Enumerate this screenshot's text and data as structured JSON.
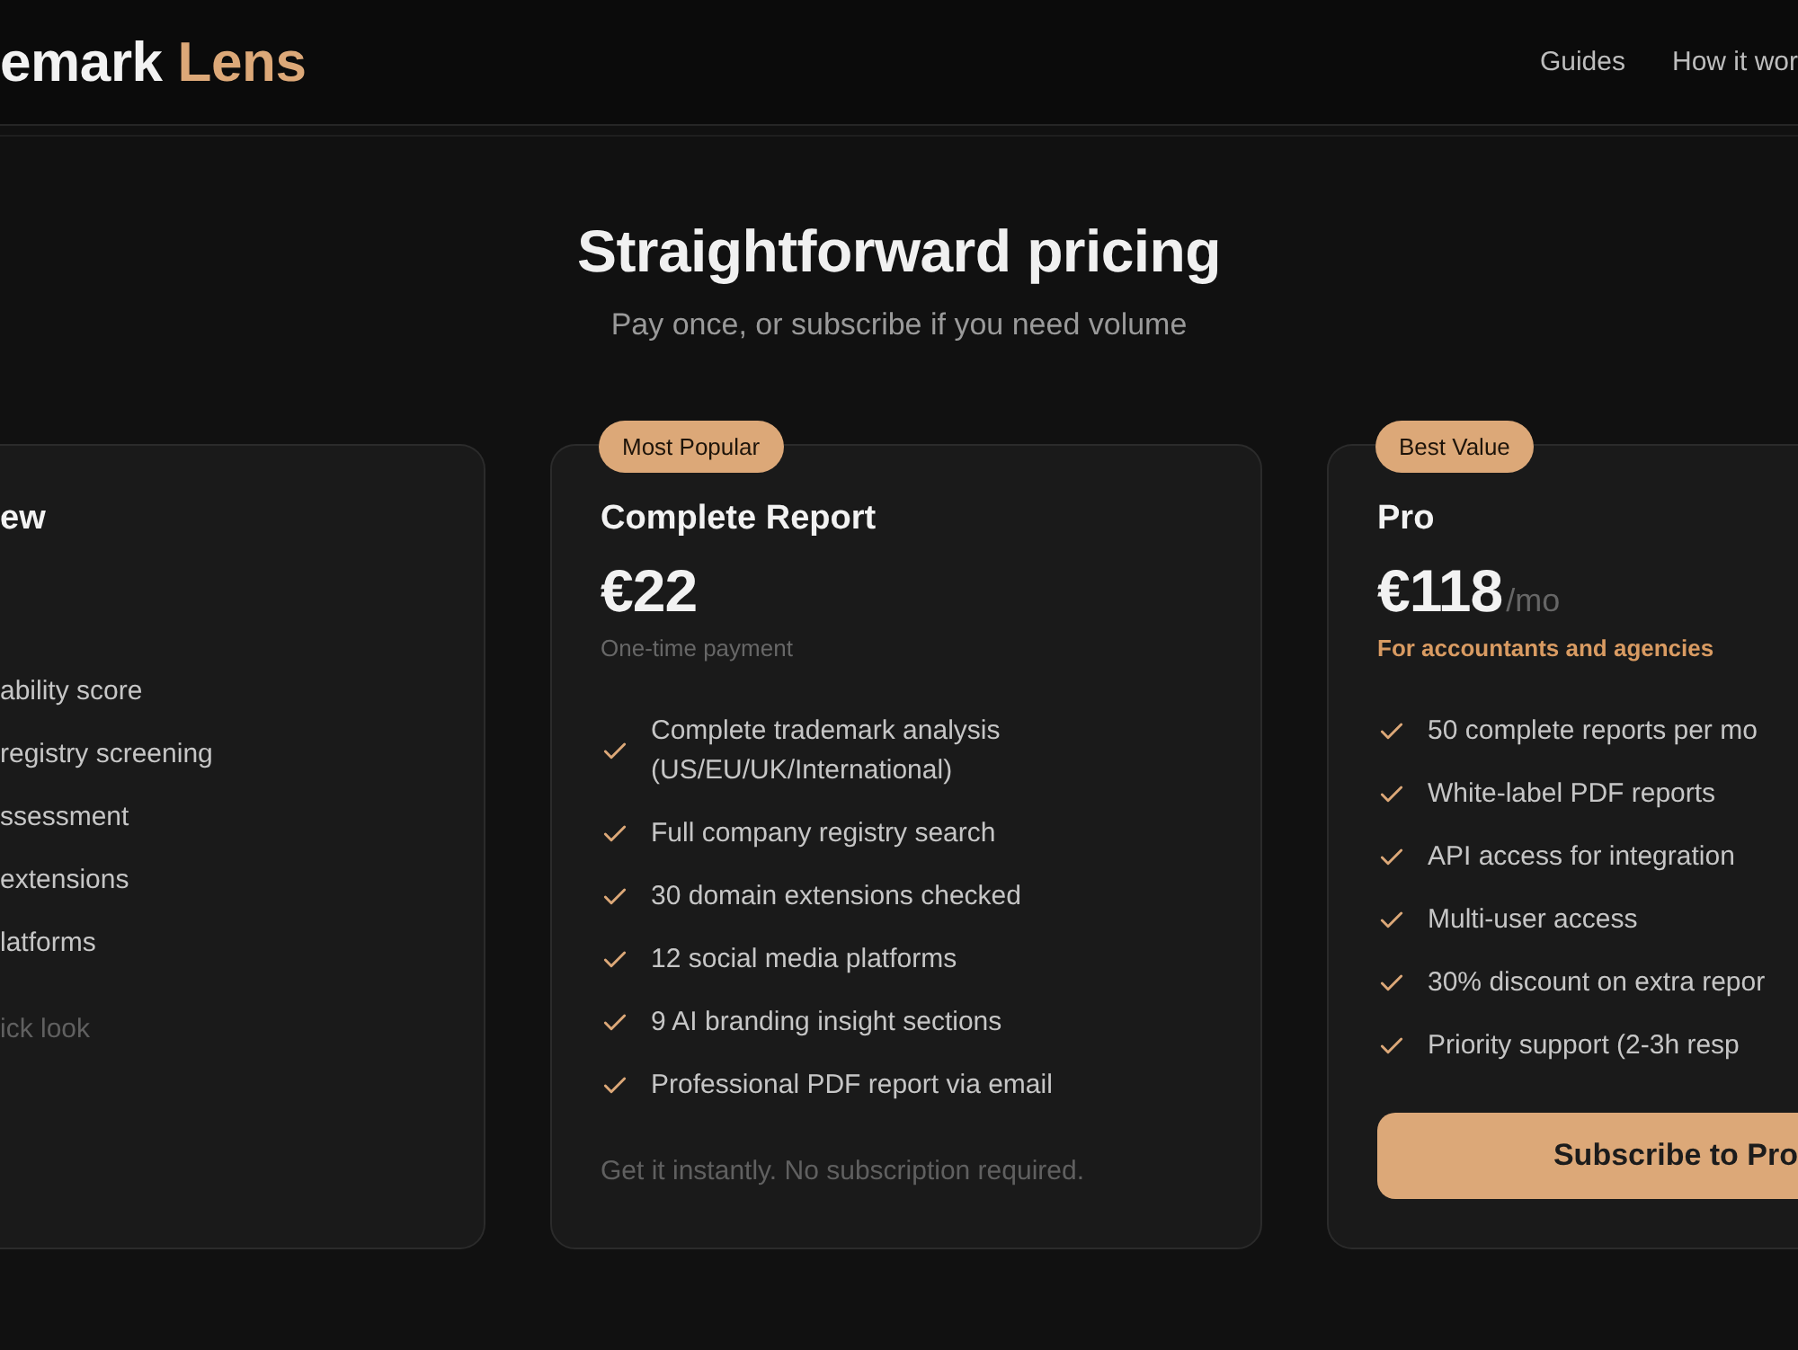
{
  "header": {
    "logo": {
      "text": "emark",
      "accent": "Lens"
    },
    "nav": [
      {
        "label": "Guides"
      },
      {
        "label": "How it wor"
      }
    ]
  },
  "hero": {
    "title": "Straightforward pricing",
    "subtitle": "Pay once, or subscribe if you need volume"
  },
  "plans": [
    {
      "name": "ew",
      "features": [
        "ability score",
        "registry screening",
        "ssessment",
        "extensions",
        "latforms"
      ],
      "footer_note": "ick look"
    },
    {
      "badge": "Most Popular",
      "name": "Complete Report",
      "price": "€22",
      "subtitle": {
        "text": "One-time payment",
        "highlighted": false
      },
      "features": [
        "Complete trademark analysis (US/EU/UK/International)",
        "Full company registry search",
        "30 domain extensions checked",
        "12 social media platforms",
        "9 AI branding insight sections",
        "Professional PDF report via email"
      ],
      "footer_note": "Get it instantly. No subscription required."
    },
    {
      "badge": "Best Value",
      "name": "Pro",
      "price": "€118",
      "period": "/mo",
      "subtitle": {
        "text": "For accountants and agencies",
        "highlighted": true
      },
      "features": [
        "50 complete reports per mo",
        "White-label PDF reports",
        "API access for integration",
        "Multi-user access",
        "30% discount on extra repor",
        "Priority support (2-3h resp"
      ],
      "button": {
        "label": "Subscribe to Pro"
      }
    }
  ]
}
